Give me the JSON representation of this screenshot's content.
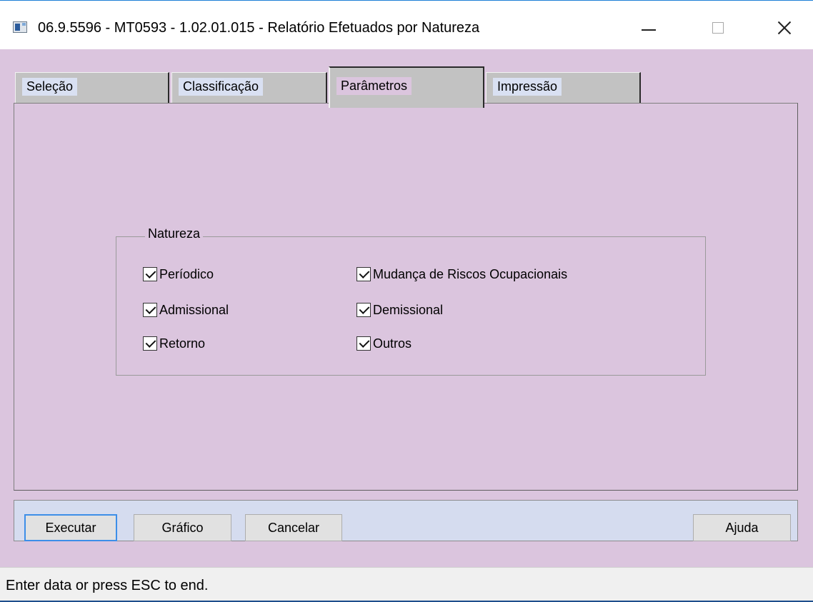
{
  "window": {
    "title": "06.9.5596 - MT0593 - 1.02.01.015 - Relatório Efetuados por Natureza"
  },
  "tabs": [
    {
      "label": "Seleção",
      "active": false
    },
    {
      "label": "Classificação",
      "active": false
    },
    {
      "label": "Parâmetros",
      "active": true
    },
    {
      "label": "Impressão",
      "active": false
    }
  ],
  "natureza": {
    "legend": "Natureza",
    "options": [
      {
        "label": "Períodico",
        "checked": true
      },
      {
        "label": "Admissional",
        "checked": true
      },
      {
        "label": "Retorno",
        "checked": true
      },
      {
        "label": "Mudança de Riscos Ocupacionais",
        "checked": true
      },
      {
        "label": "Demissional",
        "checked": true
      },
      {
        "label": "Outros",
        "checked": true
      }
    ]
  },
  "buttons": {
    "executar": "Executar",
    "grafico": "Gráfico",
    "cancelar": "Cancelar",
    "ajuda": "Ajuda"
  },
  "status": {
    "message": "Enter data or press ESC to end."
  },
  "colors": {
    "client_background": "#dbc5de",
    "toolbar_background": "#d5dcef",
    "tab_background": "#c2c2c2",
    "default_button_border": "#3d8ee8"
  },
  "icons": {
    "app": "app-window-icon",
    "minimize": "minimize-icon",
    "maximize": "maximize-icon",
    "close": "close-icon",
    "checkbox_checked": "checkmark-icon"
  }
}
